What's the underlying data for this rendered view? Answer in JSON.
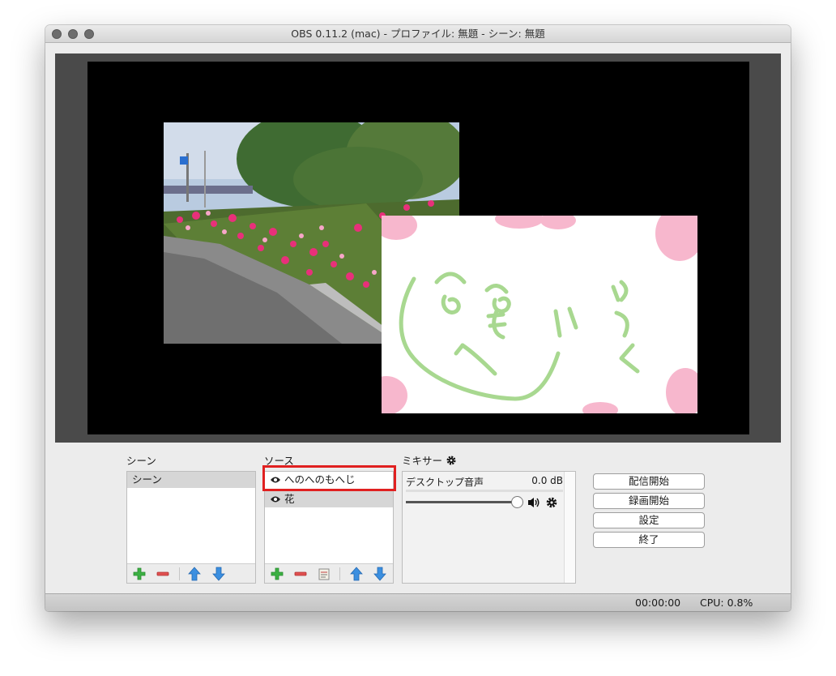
{
  "window": {
    "title": "OBS 0.11.2 (mac) - プロファイル: 無題 - シーン: 無題"
  },
  "scenes": {
    "label": "シーン",
    "items": [
      {
        "label": "シーン",
        "selected": true
      }
    ]
  },
  "sources": {
    "label": "ソース",
    "items": [
      {
        "label": "へのへのもへじ",
        "visible": true,
        "selected": false,
        "highlighted": true
      },
      {
        "label": "花",
        "visible": true,
        "selected": true
      }
    ]
  },
  "mixer": {
    "label": "ミキサー",
    "channels": [
      {
        "name": "デスクトップ音声",
        "level": "0.0 dB",
        "volume": 1.0
      }
    ]
  },
  "actions": {
    "stream": "配信開始",
    "record": "録画開始",
    "settings": "設定",
    "exit": "終了"
  },
  "status": {
    "time": "00:00:00",
    "cpu": "CPU: 0.8%"
  },
  "colors": {
    "highlight": "#e02020",
    "add": "#3cb043",
    "remove": "#e05050",
    "arrow": "#3b8fe0"
  },
  "icons": {
    "visibility": "eye-icon",
    "add": "plus-icon",
    "remove": "minus-icon",
    "properties": "properties-icon",
    "up": "arrow-up-icon",
    "down": "arrow-down-icon",
    "settings": "gear-icon",
    "speaker": "speaker-icon"
  }
}
